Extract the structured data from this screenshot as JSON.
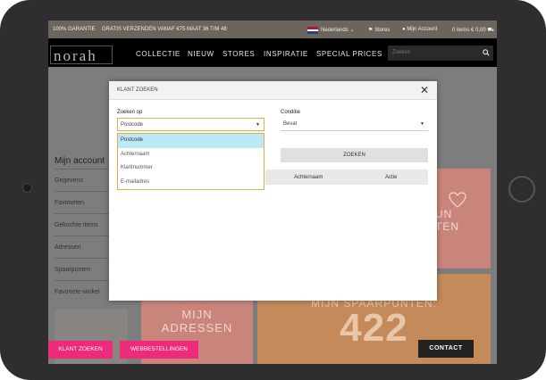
{
  "topbar": {
    "guarantee": "100% GARANTIE",
    "shipping": "GRATIS VERZENDEN VANAF €75",
    "sizes": "MAAT 36 T/M 48",
    "language": "Nederlands",
    "stores": "Stores",
    "my_account": "Mijn Account",
    "cart": "0 items € 0,00"
  },
  "nav": {
    "logo": "norah",
    "items": [
      "COLLECTIE",
      "NIEUW",
      "STORES",
      "INSPIRATIE",
      "SPECIAL PRICES"
    ],
    "search_placeholder": "Zoeken"
  },
  "account": {
    "title": "Mijn account",
    "menu": [
      "Gegevens",
      "Favorieten",
      "Gekochte items",
      "Adressen",
      "Spaarpunten",
      "Favoriete winkel"
    ]
  },
  "tiles": {
    "favorieten_partial_1": "UN",
    "favorieten_partial_2": "TEN",
    "adressen": [
      "MIJN",
      "ADRESSEN"
    ],
    "spaarpunten_label": "MIJN SPAARPUNTEN:",
    "spaarpunten_value": "422"
  },
  "modal": {
    "title": "KLANT ZOEKEN",
    "search_by_label": "Zoeken op",
    "search_by_value": "Postcode",
    "condition_label": "Conditie",
    "condition_value": "Bevat",
    "options": [
      "Postcode",
      "Achternaam",
      "Klantnummer",
      "E-mailadres"
    ],
    "search_button": "ZOEKEN",
    "columns": [
      "Achternaam",
      "Actie"
    ]
  },
  "bottom": {
    "klant_zoeken": "KLANT ZOEKEN",
    "webbestellingen": "WEBBESTELLINGEN",
    "contact": "CONTACT"
  },
  "colors": {
    "accent_pink": "#ee2a7b",
    "tile_pink": "#e4a49a",
    "tile_orange": "#e49a5c"
  }
}
